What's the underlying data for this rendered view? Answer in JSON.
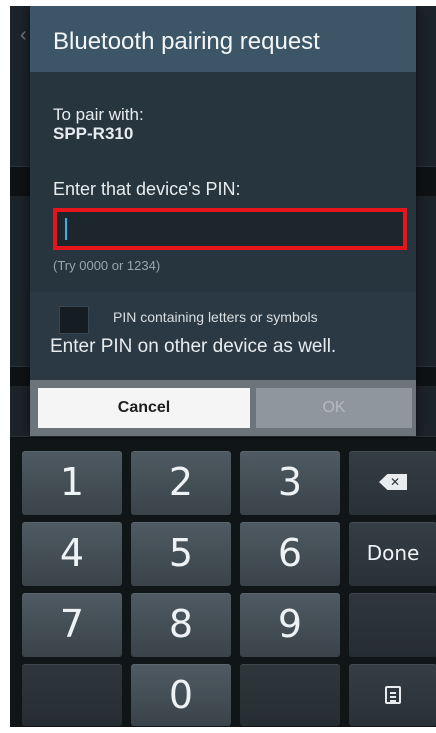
{
  "dialog": {
    "title": "Bluetooth pairing request",
    "pair_label": "To pair with:",
    "device_name": "SPP-R310",
    "pin_label": "Enter that device's PIN:",
    "pin_value": "",
    "pin_hint": "(Try 0000 or 1234)",
    "checkbox_label": "PIN containing letters or symbols",
    "checkbox_checked": false,
    "also_enter_label": "Enter PIN on other device as well.",
    "cancel_label": "Cancel",
    "ok_label": "OK"
  },
  "keypad": {
    "keys": [
      "1",
      "2",
      "3",
      "4",
      "5",
      "6",
      "7",
      "8",
      "9",
      "0"
    ],
    "done_label": "Done",
    "backspace_icon": "backspace-icon",
    "clipboard_icon": "clipboard-icon"
  },
  "colors": {
    "header": "#3c5667",
    "focus_border": "#e4161c",
    "cursor": "#33b5e5"
  }
}
